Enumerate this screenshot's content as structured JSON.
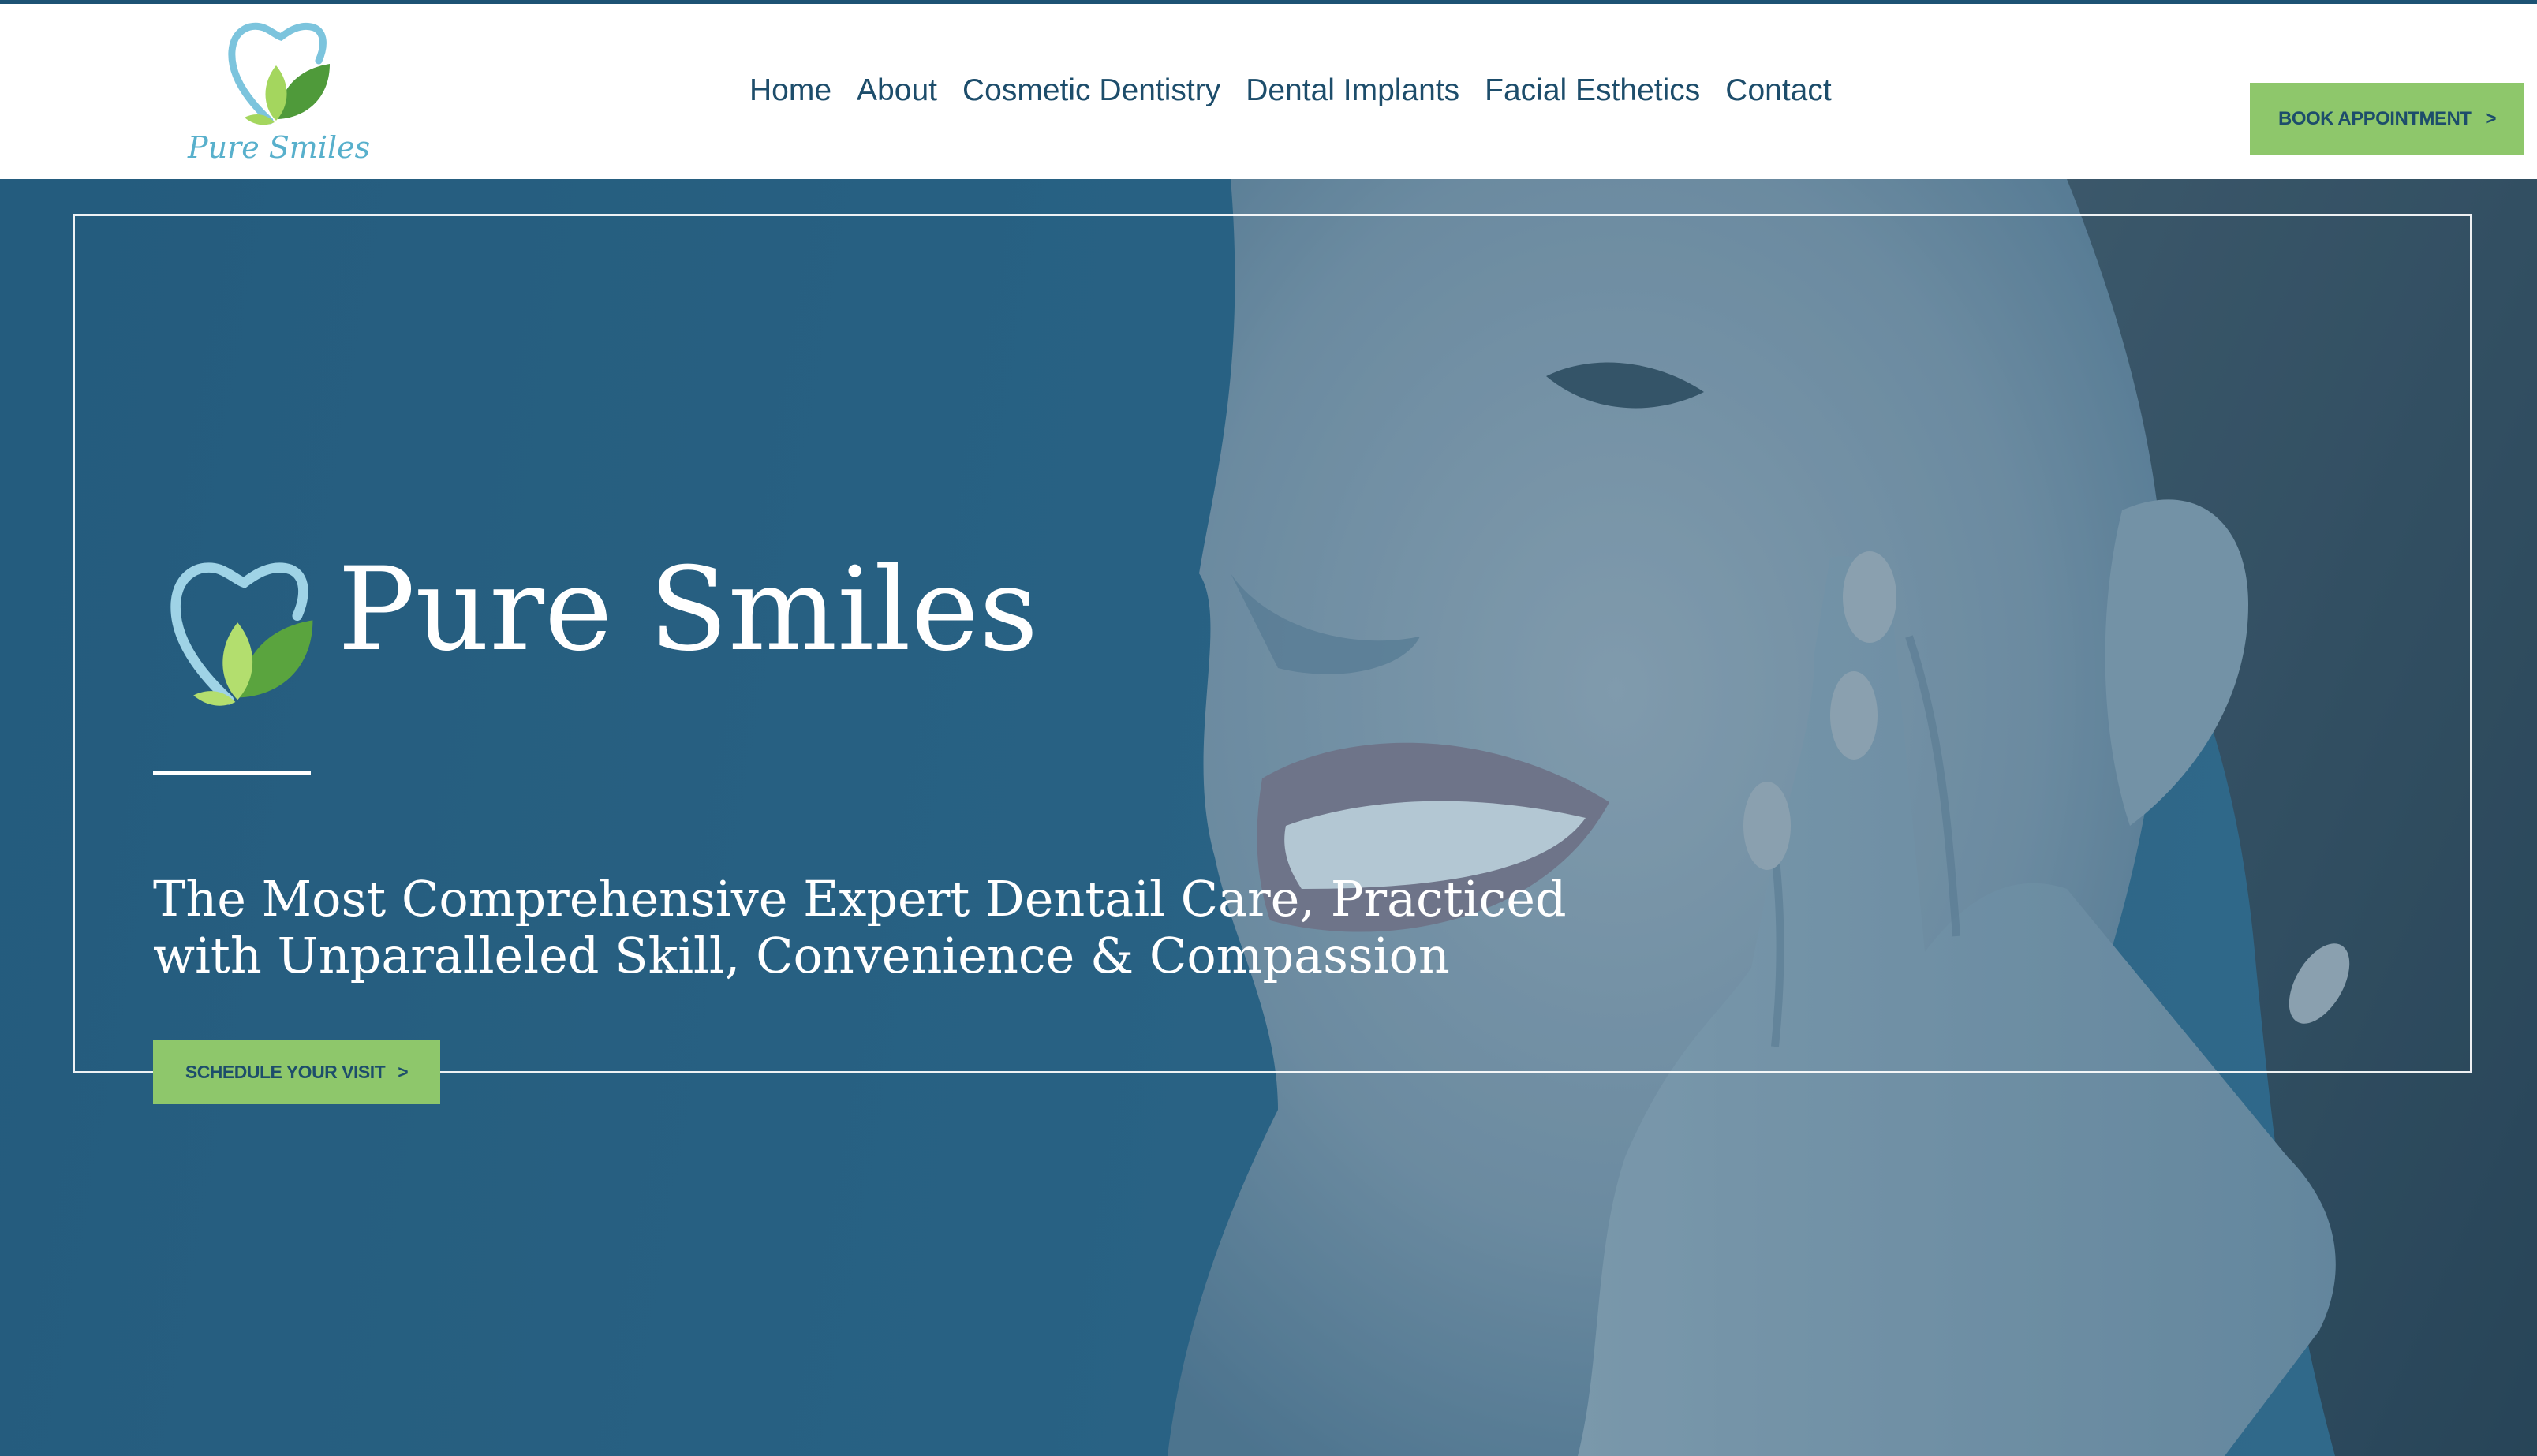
{
  "brand": {
    "name": "Pure Smiles"
  },
  "nav": {
    "items": [
      {
        "label": "Home"
      },
      {
        "label": "About"
      },
      {
        "label": "Cosmetic Dentistry"
      },
      {
        "label": "Dental Implants"
      },
      {
        "label": "Facial Esthetics"
      },
      {
        "label": "Contact"
      }
    ]
  },
  "header": {
    "book_label": "BOOK APPOINTMENT",
    "book_arrow": ">"
  },
  "hero": {
    "title": "Pure Smiles",
    "tagline_line1": "The Most Comprehensive Expert Dentail Care, Practiced",
    "tagline_line2": "with Unparalleled Skill, Convenience & Compassion",
    "cta_label": "SCHEDULE YOUR VISIT",
    "cta_arrow": ">"
  },
  "colors": {
    "header_bg": "#ffffff",
    "nav_text": "#1d4d6b",
    "accent_green": "#8ec76b",
    "hero_blue": "#2f6585",
    "logo_blue": "#7cc4dd",
    "logo_leaf_light": "#a4d65e",
    "logo_leaf_dark": "#4f9a3a"
  },
  "icons": {
    "logo": "tooth-leaves-logo-icon",
    "arrow": "chevron-right-icon"
  }
}
